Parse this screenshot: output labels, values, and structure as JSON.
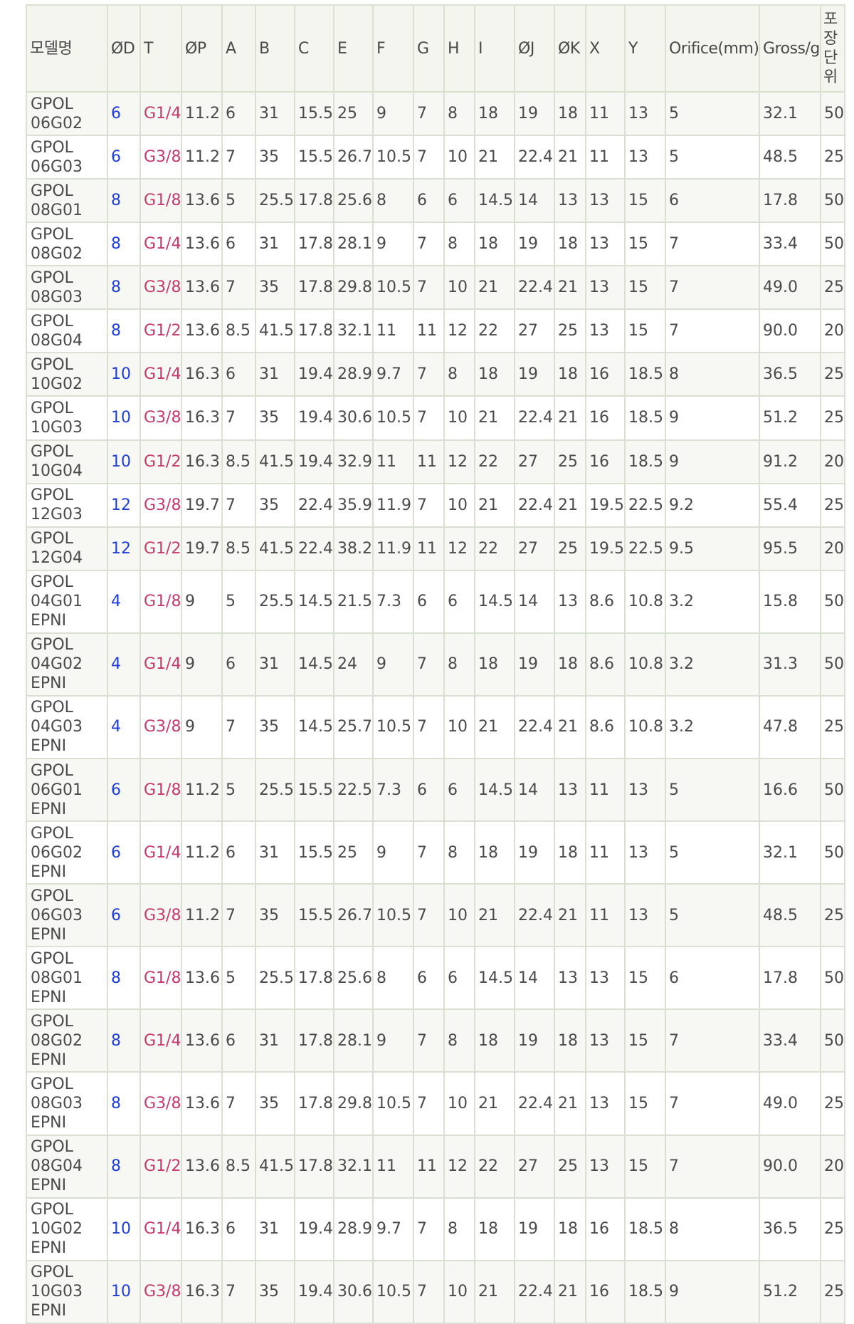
{
  "table": {
    "headers": [
      "모델명",
      "ØD",
      "T",
      "ØP",
      "A",
      "B",
      "C",
      "E",
      "F",
      "G",
      "H",
      "I",
      "ØJ",
      "ØK",
      "X",
      "Y",
      "Orifice(mm)",
      "Gross/g",
      "포장단위"
    ],
    "rows": [
      {
        "model": "GPOL 06G02",
        "cells": [
          "6",
          "G1/4",
          "11.2",
          "6",
          "31",
          "15.5",
          "25",
          "9",
          "7",
          "8",
          "18",
          "19",
          "18",
          "11",
          "13",
          "5",
          "32.1",
          "50"
        ]
      },
      {
        "model": "GPOL 06G03",
        "cells": [
          "6",
          "G3/8",
          "11.2",
          "7",
          "35",
          "15.5",
          "26.7",
          "10.5",
          "7",
          "10",
          "21",
          "22.4",
          "21",
          "11",
          "13",
          "5",
          "48.5",
          "25"
        ]
      },
      {
        "model": "GPOL 08G01",
        "cells": [
          "8",
          "G1/8",
          "13.6",
          "5",
          "25.5",
          "17.8",
          "25.6",
          "8",
          "6",
          "6",
          "14.5",
          "14",
          "13",
          "13",
          "15",
          "6",
          "17.8",
          "50"
        ]
      },
      {
        "model": "GPOL 08G02",
        "cells": [
          "8",
          "G1/4",
          "13.6",
          "6",
          "31",
          "17.8",
          "28.1",
          "9",
          "7",
          "8",
          "18",
          "19",
          "18",
          "13",
          "15",
          "7",
          "33.4",
          "50"
        ]
      },
      {
        "model": "GPOL 08G03",
        "cells": [
          "8",
          "G3/8",
          "13.6",
          "7",
          "35",
          "17.8",
          "29.8",
          "10.5",
          "7",
          "10",
          "21",
          "22.4",
          "21",
          "13",
          "15",
          "7",
          "49.0",
          "25"
        ]
      },
      {
        "model": "GPOL 08G04",
        "cells": [
          "8",
          "G1/2",
          "13.6",
          "8.5",
          "41.5",
          "17.8",
          "32.1",
          "11",
          "11",
          "12",
          "22",
          "27",
          "25",
          "13",
          "15",
          "7",
          "90.0",
          "20"
        ]
      },
      {
        "model": "GPOL 10G02",
        "cells": [
          "10",
          "G1/4",
          "16.3",
          "6",
          "31",
          "19.4",
          "28.9",
          "9.7",
          "7",
          "8",
          "18",
          "19",
          "18",
          "16",
          "18.5",
          "8",
          "36.5",
          "25"
        ]
      },
      {
        "model": "GPOL 10G03",
        "cells": [
          "10",
          "G3/8",
          "16.3",
          "7",
          "35",
          "19.4",
          "30.6",
          "10.5",
          "7",
          "10",
          "21",
          "22.4",
          "21",
          "16",
          "18.5",
          "9",
          "51.2",
          "25"
        ]
      },
      {
        "model": "GPOL 10G04",
        "cells": [
          "10",
          "G1/2",
          "16.3",
          "8.5",
          "41.5",
          "19.4",
          "32.9",
          "11",
          "11",
          "12",
          "22",
          "27",
          "25",
          "16",
          "18.5",
          "9",
          "91.2",
          "20"
        ]
      },
      {
        "model": "GPOL 12G03",
        "cells": [
          "12",
          "G3/8",
          "19.7",
          "7",
          "35",
          "22.4",
          "35.9",
          "11.9",
          "7",
          "10",
          "21",
          "22.4",
          "21",
          "19.5",
          "22.5",
          "9.2",
          "55.4",
          "25"
        ]
      },
      {
        "model": "GPOL 12G04",
        "cells": [
          "12",
          "G1/2",
          "19.7",
          "8.5",
          "41.5",
          "22.4",
          "38.2",
          "11.9",
          "11",
          "12",
          "22",
          "27",
          "25",
          "19.5",
          "22.5",
          "9.5",
          "95.5",
          "20"
        ]
      },
      {
        "model": "GPOL 04G01 EPNI",
        "cells": [
          "4",
          "G1/8",
          "9",
          "5",
          "25.5",
          "14.5",
          "21.5",
          "7.3",
          "6",
          "6",
          "14.5",
          "14",
          "13",
          "8.6",
          "10.8",
          "3.2",
          "15.8",
          "50"
        ]
      },
      {
        "model": "GPOL 04G02 EPNI",
        "cells": [
          "4",
          "G1/4",
          "9",
          "6",
          "31",
          "14.5",
          "24",
          "9",
          "7",
          "8",
          "18",
          "19",
          "18",
          "8.6",
          "10.8",
          "3.2",
          "31.3",
          "50"
        ]
      },
      {
        "model": "GPOL 04G03 EPNI",
        "cells": [
          "4",
          "G3/8",
          "9",
          "7",
          "35",
          "14.5",
          "25.7",
          "10.5",
          "7",
          "10",
          "21",
          "22.4",
          "21",
          "8.6",
          "10.8",
          "3.2",
          "47.8",
          "25"
        ]
      },
      {
        "model": "GPOL 06G01 EPNI",
        "cells": [
          "6",
          "G1/8",
          "11.2",
          "5",
          "25.5",
          "15.5",
          "22.5",
          "7.3",
          "6",
          "6",
          "14.5",
          "14",
          "13",
          "11",
          "13",
          "5",
          "16.6",
          "50"
        ]
      },
      {
        "model": "GPOL 06G02 EPNI",
        "cells": [
          "6",
          "G1/4",
          "11.2",
          "6",
          "31",
          "15.5",
          "25",
          "9",
          "7",
          "8",
          "18",
          "19",
          "18",
          "11",
          "13",
          "5",
          "32.1",
          "50"
        ]
      },
      {
        "model": "GPOL 06G03 EPNI",
        "cells": [
          "6",
          "G3/8",
          "11.2",
          "7",
          "35",
          "15.5",
          "26.7",
          "10.5",
          "7",
          "10",
          "21",
          "22.4",
          "21",
          "11",
          "13",
          "5",
          "48.5",
          "25"
        ]
      },
      {
        "model": "GPOL 08G01 EPNI",
        "cells": [
          "8",
          "G1/8",
          "13.6",
          "5",
          "25.5",
          "17.8",
          "25.6",
          "8",
          "6",
          "6",
          "14.5",
          "14",
          "13",
          "13",
          "15",
          "6",
          "17.8",
          "50"
        ]
      },
      {
        "model": "GPOL 08G02 EPNI",
        "cells": [
          "8",
          "G1/4",
          "13.6",
          "6",
          "31",
          "17.8",
          "28.1",
          "9",
          "7",
          "8",
          "18",
          "19",
          "18",
          "13",
          "15",
          "7",
          "33.4",
          "50"
        ]
      },
      {
        "model": "GPOL 08G03 EPNI",
        "cells": [
          "8",
          "G3/8",
          "13.6",
          "7",
          "35",
          "17.8",
          "29.8",
          "10.5",
          "7",
          "10",
          "21",
          "22.4",
          "21",
          "13",
          "15",
          "7",
          "49.0",
          "25"
        ]
      },
      {
        "model": "GPOL 08G04 EPNI",
        "cells": [
          "8",
          "G1/2",
          "13.6",
          "8.5",
          "41.5",
          "17.8",
          "32.1",
          "11",
          "11",
          "12",
          "22",
          "27",
          "25",
          "13",
          "15",
          "7",
          "90.0",
          "20"
        ]
      },
      {
        "model": "GPOL 10G02 EPNI",
        "cells": [
          "10",
          "G1/4",
          "16.3",
          "6",
          "31",
          "19.4",
          "28.9",
          "9.7",
          "7",
          "8",
          "18",
          "19",
          "18",
          "16",
          "18.5",
          "8",
          "36.5",
          "25"
        ]
      },
      {
        "model": "GPOL 10G03 EPNI",
        "cells": [
          "10",
          "G3/8",
          "16.3",
          "7",
          "35",
          "19.4",
          "30.6",
          "10.5",
          "7",
          "10",
          "21",
          "22.4",
          "21",
          "16",
          "18.5",
          "9",
          "51.2",
          "25"
        ]
      }
    ]
  },
  "colors": {
    "od_text": "#1f3fd8",
    "thread_text": "#c43a6d",
    "body_text": "#4a4a4a",
    "grid_line": "#d9e0d2",
    "header_bg": "#f3f5ee",
    "row_alt_bg": "#f7f8f4"
  }
}
